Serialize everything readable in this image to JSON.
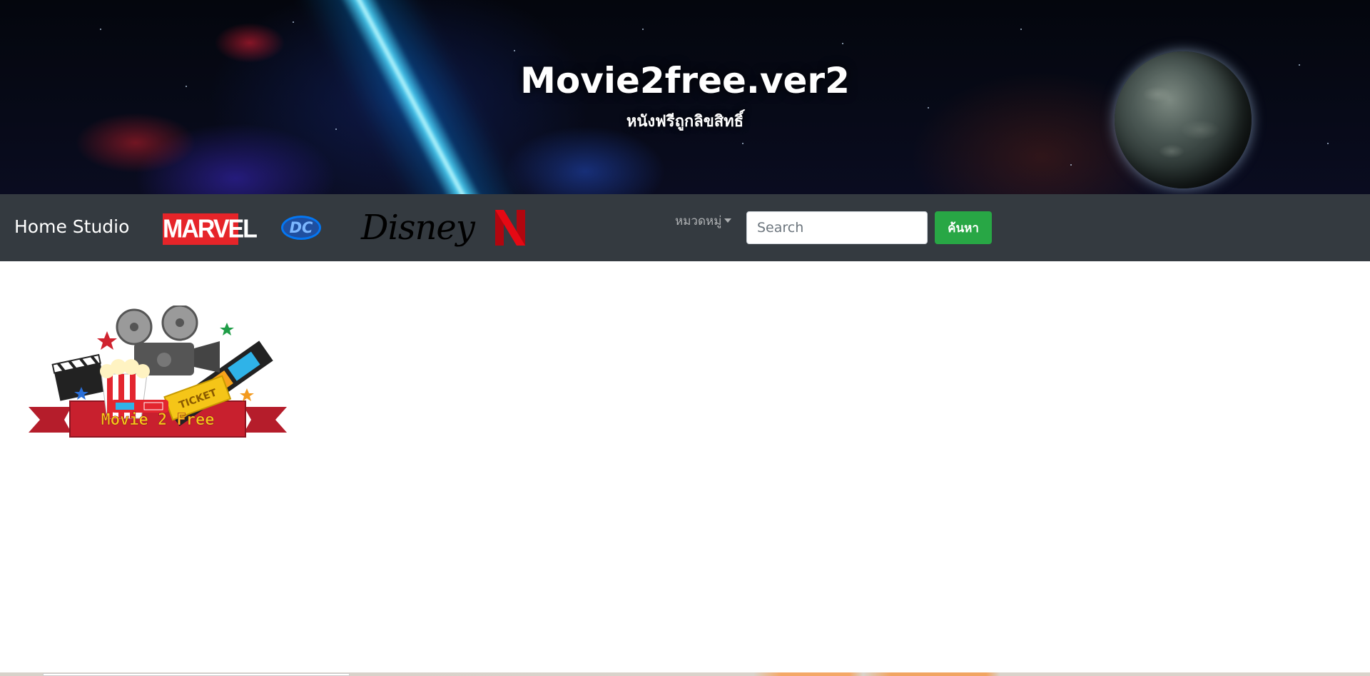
{
  "header": {
    "title": "Movie2free.ver2",
    "subtitle": "หนังฟรีถูกลิขสิทธิ์"
  },
  "navbar": {
    "brand": "Home Studio",
    "studios": [
      {
        "name": "marvel",
        "label": "MARVEL",
        "color": "#e62429"
      },
      {
        "name": "dc",
        "label": "DC",
        "color": "#0476f2"
      },
      {
        "name": "disney",
        "label": "Disney",
        "color": "#000000"
      },
      {
        "name": "netflix",
        "label": "N",
        "color": "#e50914"
      }
    ],
    "category_dropdown": "หมวดหมู่",
    "search": {
      "placeholder": "Search",
      "value": ""
    },
    "search_button": "ค้นหา"
  },
  "logo": {
    "text": "Movie 2 Free",
    "ticket_text": "TICKET"
  },
  "colors": {
    "navbar_bg": "#343a40",
    "search_button_bg": "#28a745",
    "logo_banner": "#c8202e"
  }
}
